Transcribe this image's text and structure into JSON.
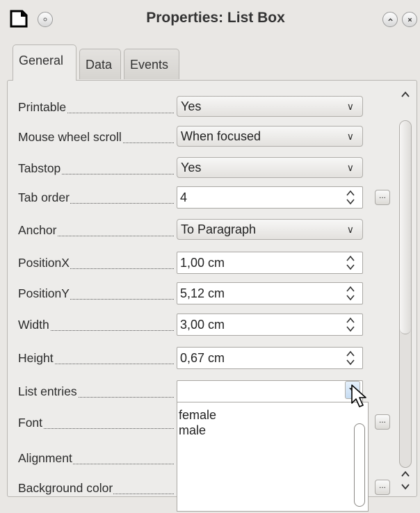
{
  "window": {
    "title": "Properties: List Box",
    "icons": [
      "app-document-icon",
      "pin-icon",
      "minimize-icon",
      "close-icon"
    ]
  },
  "tabs": [
    {
      "label": "General",
      "active": true
    },
    {
      "label": "Data",
      "active": false
    },
    {
      "label": "Events",
      "active": false
    }
  ],
  "properties": [
    {
      "label": "Printable",
      "type": "combo",
      "value": "Yes"
    },
    {
      "label": "Mouse wheel scroll",
      "type": "combo",
      "value": "When focused"
    },
    {
      "label": "Tabstop",
      "type": "combo",
      "value": "Yes"
    },
    {
      "label": "Tab order",
      "type": "spin",
      "value": "4",
      "has_dots_button": true
    },
    {
      "label": "Anchor",
      "type": "combo",
      "value": "To Paragraph"
    },
    {
      "label": "PositionX",
      "type": "spin",
      "value": "1,00 cm"
    },
    {
      "label": "PositionY",
      "type": "spin",
      "value": "5,12 cm"
    },
    {
      "label": "Width",
      "type": "spin",
      "value": "3,00 cm"
    },
    {
      "label": "Height",
      "type": "spin",
      "value": "0,67 cm"
    },
    {
      "label": "List entries",
      "type": "list-editor",
      "value": ""
    },
    {
      "label": "Font",
      "type": "none",
      "value": "",
      "has_dots_button": true
    },
    {
      "label": "Alignment",
      "type": "none",
      "value": ""
    },
    {
      "label": "Background color",
      "type": "none",
      "value": "",
      "has_dots_button": true
    }
  ],
  "list_entries_dropdown": {
    "items": [
      "female",
      "male"
    ]
  },
  "dots_label": "..."
}
